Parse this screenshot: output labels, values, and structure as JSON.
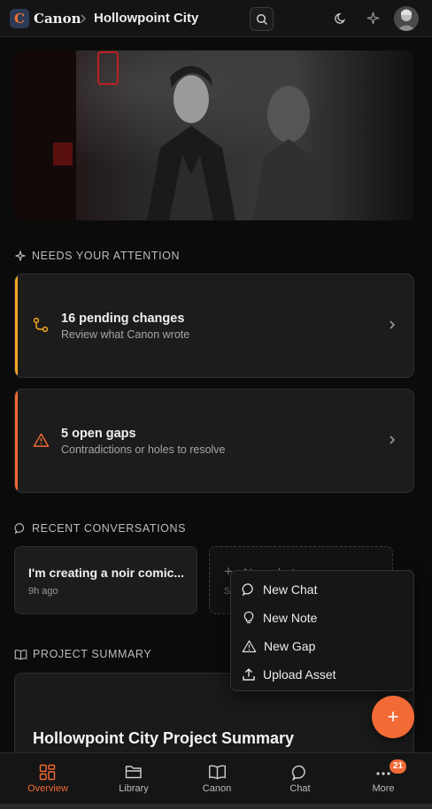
{
  "header": {
    "logo_letter": "C",
    "app_name": "Canon",
    "separator": ">",
    "project_title": "Hollowpoint City",
    "icons": [
      "search-icon",
      "moon-icon",
      "sparkle-icon",
      "avatar"
    ]
  },
  "attention": {
    "label": "NEEDS YOUR ATTENTION",
    "items": [
      {
        "title": "16 pending changes",
        "subtitle": "Review what Canon wrote",
        "icon": "git-branch-icon",
        "accent": "#f5a623"
      },
      {
        "title": "5 open gaps",
        "subtitle": "Contradictions or holes to resolve",
        "icon": "warning-icon",
        "accent": "#f26a35"
      }
    ]
  },
  "conversations": {
    "label": "RECENT CONVERSATIONS",
    "items": [
      {
        "title": "I'm creating a noir comic...",
        "time": "9h ago"
      }
    ],
    "new_chat": {
      "label": "New chat",
      "sub": "St"
    }
  },
  "summary": {
    "label": "PROJECT SUMMARY",
    "title": "Hollowpoint City Project Summary"
  },
  "menu": {
    "items": [
      {
        "label": "New Chat",
        "icon": "chat-bubble-icon"
      },
      {
        "label": "New Note",
        "icon": "lightbulb-icon"
      },
      {
        "label": "New Gap",
        "icon": "warning-icon"
      },
      {
        "label": "Upload Asset",
        "icon": "upload-icon"
      }
    ]
  },
  "fab": {
    "label": "+"
  },
  "nav": {
    "items": [
      {
        "label": "Overview",
        "icon": "grid-icon",
        "active": true
      },
      {
        "label": "Library",
        "icon": "folder-icon"
      },
      {
        "label": "Canon",
        "icon": "book-icon"
      },
      {
        "label": "Chat",
        "icon": "chat-bubble-icon"
      },
      {
        "label": "More",
        "icon": "more-icon",
        "badge": "21"
      }
    ]
  },
  "colors": {
    "accent": "#f26a35",
    "warning": "#f5a623",
    "background": "#0b0b0b"
  }
}
